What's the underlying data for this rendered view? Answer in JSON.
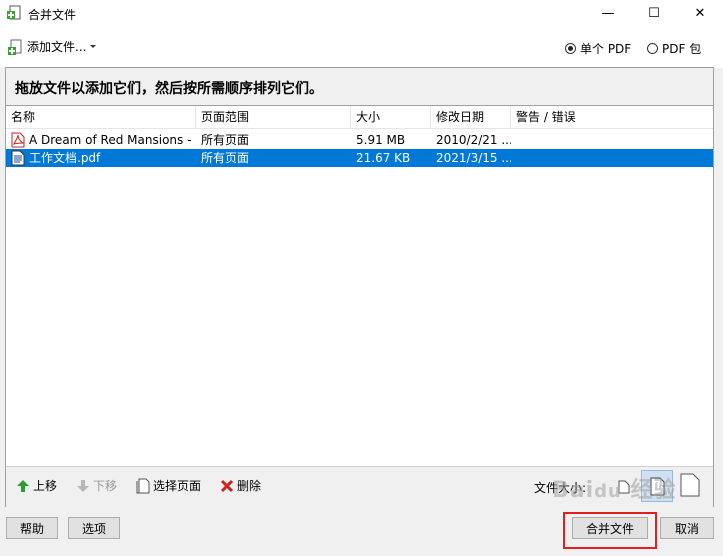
{
  "window": {
    "title": "合并文件",
    "minimize_glyph": "—",
    "maximize_glyph": "☐",
    "close_glyph": "✕"
  },
  "toolbar": {
    "add_files_label": "添加文件...",
    "output_options": [
      {
        "label": "单个 PDF",
        "selected": true
      },
      {
        "label": "PDF 包",
        "selected": false
      }
    ]
  },
  "instruction": "拖放文件以添加它们，然后按所需顺序排列它们。",
  "table": {
    "columns": [
      "名称",
      "页面范围",
      "大小",
      "修改日期",
      "警告 / 错误"
    ],
    "rows": [
      {
        "name": "A Dream of Red Mansions - C...",
        "range": "所有页面",
        "size": "5.91 MB",
        "date": "2010/2/21 ...",
        "warning": "",
        "icon": "pdf-icon",
        "selected": false
      },
      {
        "name": "工作文档.pdf",
        "range": "所有页面",
        "size": "21.67 KB",
        "date": "2021/3/15 ...",
        "warning": "",
        "icon": "pdf-doc-icon",
        "selected": true
      }
    ]
  },
  "bottom_bar": {
    "move_up": "上移",
    "move_down": "下移",
    "choose_pages": "选择页面",
    "delete": "删除",
    "file_size_label": "文件大小:"
  },
  "footer": {
    "help": "帮助",
    "options": "选项",
    "merge": "合并文件",
    "cancel": "取消"
  },
  "colors": {
    "selection": "#0078d7",
    "highlight": "#e02020",
    "move_up_arrow": "#2e9b2e",
    "delete_x": "#d02020"
  }
}
